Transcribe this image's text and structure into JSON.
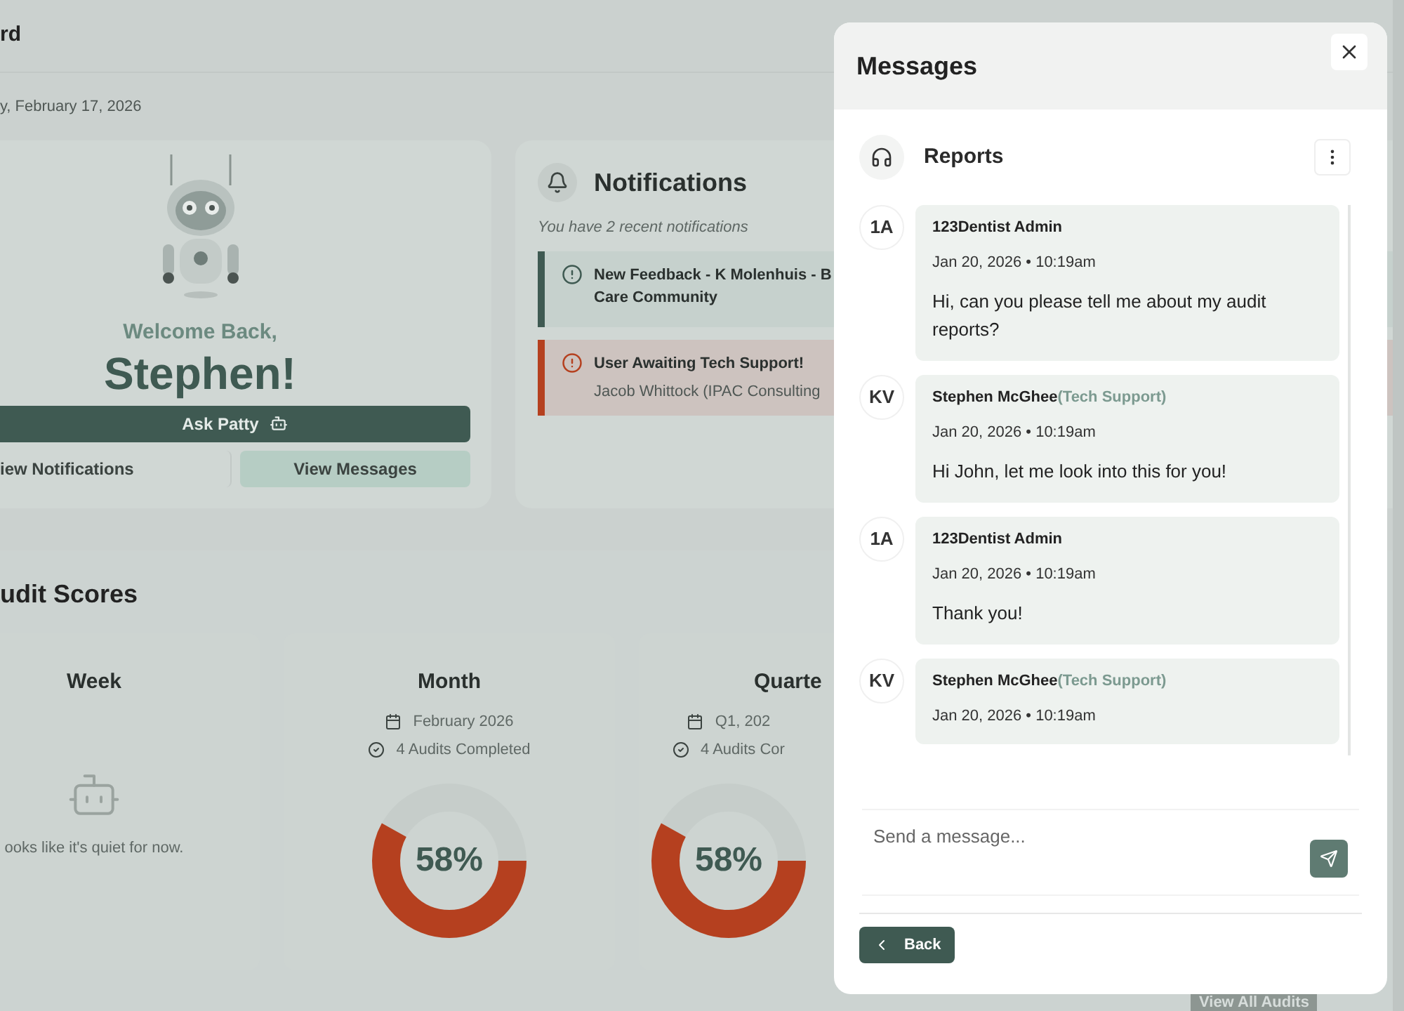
{
  "page": {
    "title": "rd",
    "date": "y, February 17, 2026"
  },
  "welcome": {
    "greeting": "Welcome Back,",
    "name": "Stephen!",
    "ask_button": "Ask Patty",
    "buttons": [
      {
        "label": "iew Notifications",
        "selected": false
      },
      {
        "label": "View Messages",
        "selected": true
      }
    ]
  },
  "notifications": {
    "title": "Notifications",
    "subtitle": "You have 2 recent notifications",
    "items": [
      {
        "kind": "feedback",
        "color": "#3f5a52",
        "title": "New Feedback - K Molenhuis - B",
        "detail": "Care Community"
      },
      {
        "kind": "alert",
        "color": "#b5401f",
        "title": "User Awaiting Tech Support!",
        "detail": "Jacob Whittock (IPAC Consulting"
      }
    ]
  },
  "audit_scores": {
    "title": "udit Scores",
    "cards": [
      {
        "kind": "empty",
        "title": "Week",
        "message": "ooks like it's quiet for now."
      },
      {
        "kind": "score",
        "title": "Month",
        "period": "February 2026",
        "completed": "4 Audits Completed",
        "level": 0.58,
        "score": "58%"
      },
      {
        "kind": "score",
        "title": "Quarte",
        "period": "Q1, 202",
        "completed": "4 Audits Cor",
        "level": 0.58,
        "score": "58%"
      }
    ],
    "view_all": "View All Audits"
  },
  "messages_dialog": {
    "title": "Messages",
    "channel": "Reports",
    "messages": [
      {
        "initials": "1A",
        "sender": "123Dentist Admin",
        "time": "Jan 20, 2026 • 10:19am",
        "text": "Hi, can you please tell me about my audit reports?"
      },
      {
        "initials": "KV",
        "sender": "Stephen McGhee",
        "role": "(Tech Support)",
        "time": "Jan 20, 2026 • 10:19am",
        "text": "Hi John, let me look into this for you!"
      },
      {
        "initials": "1A",
        "sender": "123Dentist Admin",
        "time": "Jan 20, 2026 • 10:19am",
        "text": "Thank you!"
      },
      {
        "initials": "KV",
        "sender": "Stephen McGhee",
        "role": "(Tech Support)",
        "time": "Jan 20, 2026 • 10:19am"
      }
    ],
    "composer": {
      "placeholder": "Send a message..."
    },
    "back_button": "Back"
  }
}
